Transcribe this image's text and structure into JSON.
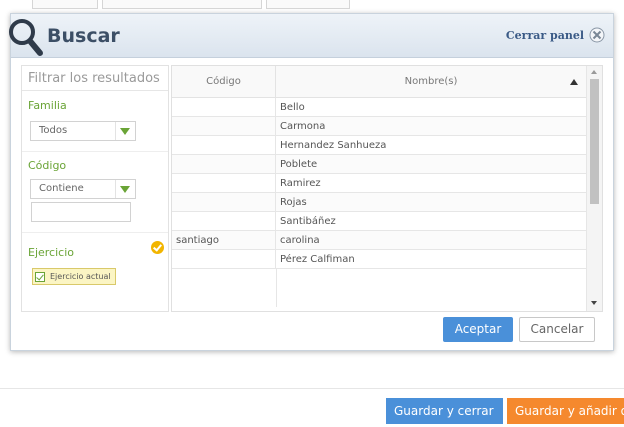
{
  "panel": {
    "title": "Buscar",
    "close_label": "Cerrar panel"
  },
  "filters": {
    "title": "Filtrar los resultados",
    "familia": {
      "label": "Familia",
      "value": "Todos"
    },
    "codigo": {
      "label": "Código",
      "operator": "Contiene",
      "value": ""
    },
    "ejercicio": {
      "label": "Ejercicio",
      "chip": "Ejercicio actual"
    }
  },
  "grid": {
    "columns": [
      "Código",
      "Nombre(s)"
    ],
    "sort": "ascending",
    "rows": [
      {
        "code": "",
        "name": "Bello"
      },
      {
        "code": "",
        "name": "Carmona"
      },
      {
        "code": "",
        "name": "Hernandez Sanhueza"
      },
      {
        "code": "",
        "name": "Poblete"
      },
      {
        "code": "",
        "name": "Ramirez"
      },
      {
        "code": "",
        "name": "Rojas"
      },
      {
        "code": "",
        "name": "Santibáñez"
      },
      {
        "code": "santiago",
        "name": "carolina"
      },
      {
        "code": "",
        "name": "Pérez Calfiman"
      }
    ]
  },
  "buttons": {
    "accept": "Aceptar",
    "cancel": "Cancelar",
    "save_close": "Guardar y cerrar",
    "save_add": "Guardar y añadir o"
  },
  "colors": {
    "accent_blue": "#4a90d9",
    "accent_orange": "#f5892e",
    "filter_green": "#6aa436",
    "check_yellow": "#f2b500"
  }
}
